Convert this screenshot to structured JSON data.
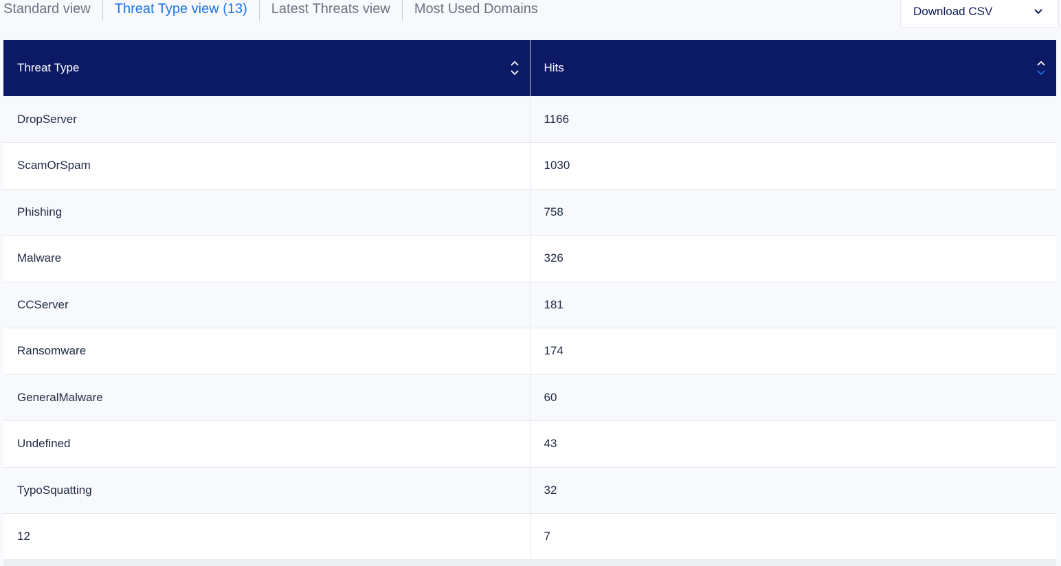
{
  "tabs": [
    {
      "label": "Standard view",
      "active": false
    },
    {
      "label": "Threat Type view (13)",
      "active": true
    },
    {
      "label": "Latest Threats view",
      "active": false
    },
    {
      "label": "Most Used Domains",
      "active": false
    }
  ],
  "download": {
    "label": "Download CSV",
    "icon": "chevron-down-icon"
  },
  "table": {
    "headers": [
      "Threat Type",
      "Hits"
    ],
    "rows": [
      [
        "DropServer",
        "1166"
      ],
      [
        "ScamOrSpam",
        "1030"
      ],
      [
        "Phishing",
        "758"
      ],
      [
        "Malware",
        "326"
      ],
      [
        "CCServer",
        "181"
      ],
      [
        "Ransomware",
        "174"
      ],
      [
        "GeneralMalware",
        "60"
      ],
      [
        "Undefined",
        "43"
      ],
      [
        "TypoSquatting",
        "32"
      ],
      [
        "12",
        "7"
      ]
    ]
  },
  "colors": {
    "header_bg": "#0c1a66",
    "active_tab": "#1a73e8",
    "sort_active": "#1a73e8"
  }
}
